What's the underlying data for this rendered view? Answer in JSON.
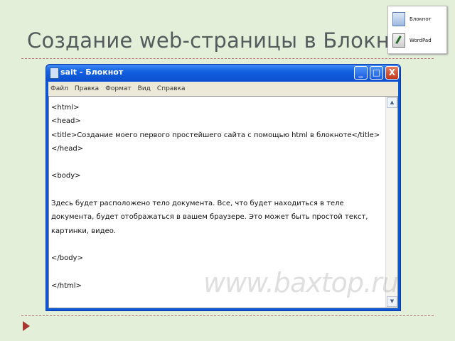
{
  "slide": {
    "title": "Создание web-страницы в Блокнот",
    "accent_color": "#a8352f"
  },
  "thumbnails": [
    {
      "icon": "notepad-icon",
      "label": "Блокнот"
    },
    {
      "icon": "wordpad-icon",
      "label": "WordPad"
    }
  ],
  "window": {
    "title": "sait - Блокнот",
    "buttons": {
      "minimize": "_",
      "maximize": "□",
      "close": "X"
    },
    "menu": [
      "Файл",
      "Правка",
      "Формат",
      "Вид",
      "Справка"
    ],
    "content_lines": [
      "<html>",
      "<head>",
      "<title>Создание моего первого простейшего сайта с помощью html в блокноте</title>",
      "</head>",
      "",
      "<body>",
      "",
      "Здесь будет расположено тело документа. Все, что будет находиться в теле",
      "документа, будет отображаться в вашем браузере. Это может быть простой текст,",
      "картинки, видео.",
      "",
      "</body>",
      "",
      "</html>"
    ]
  },
  "watermark": "www.baxtop.ru"
}
